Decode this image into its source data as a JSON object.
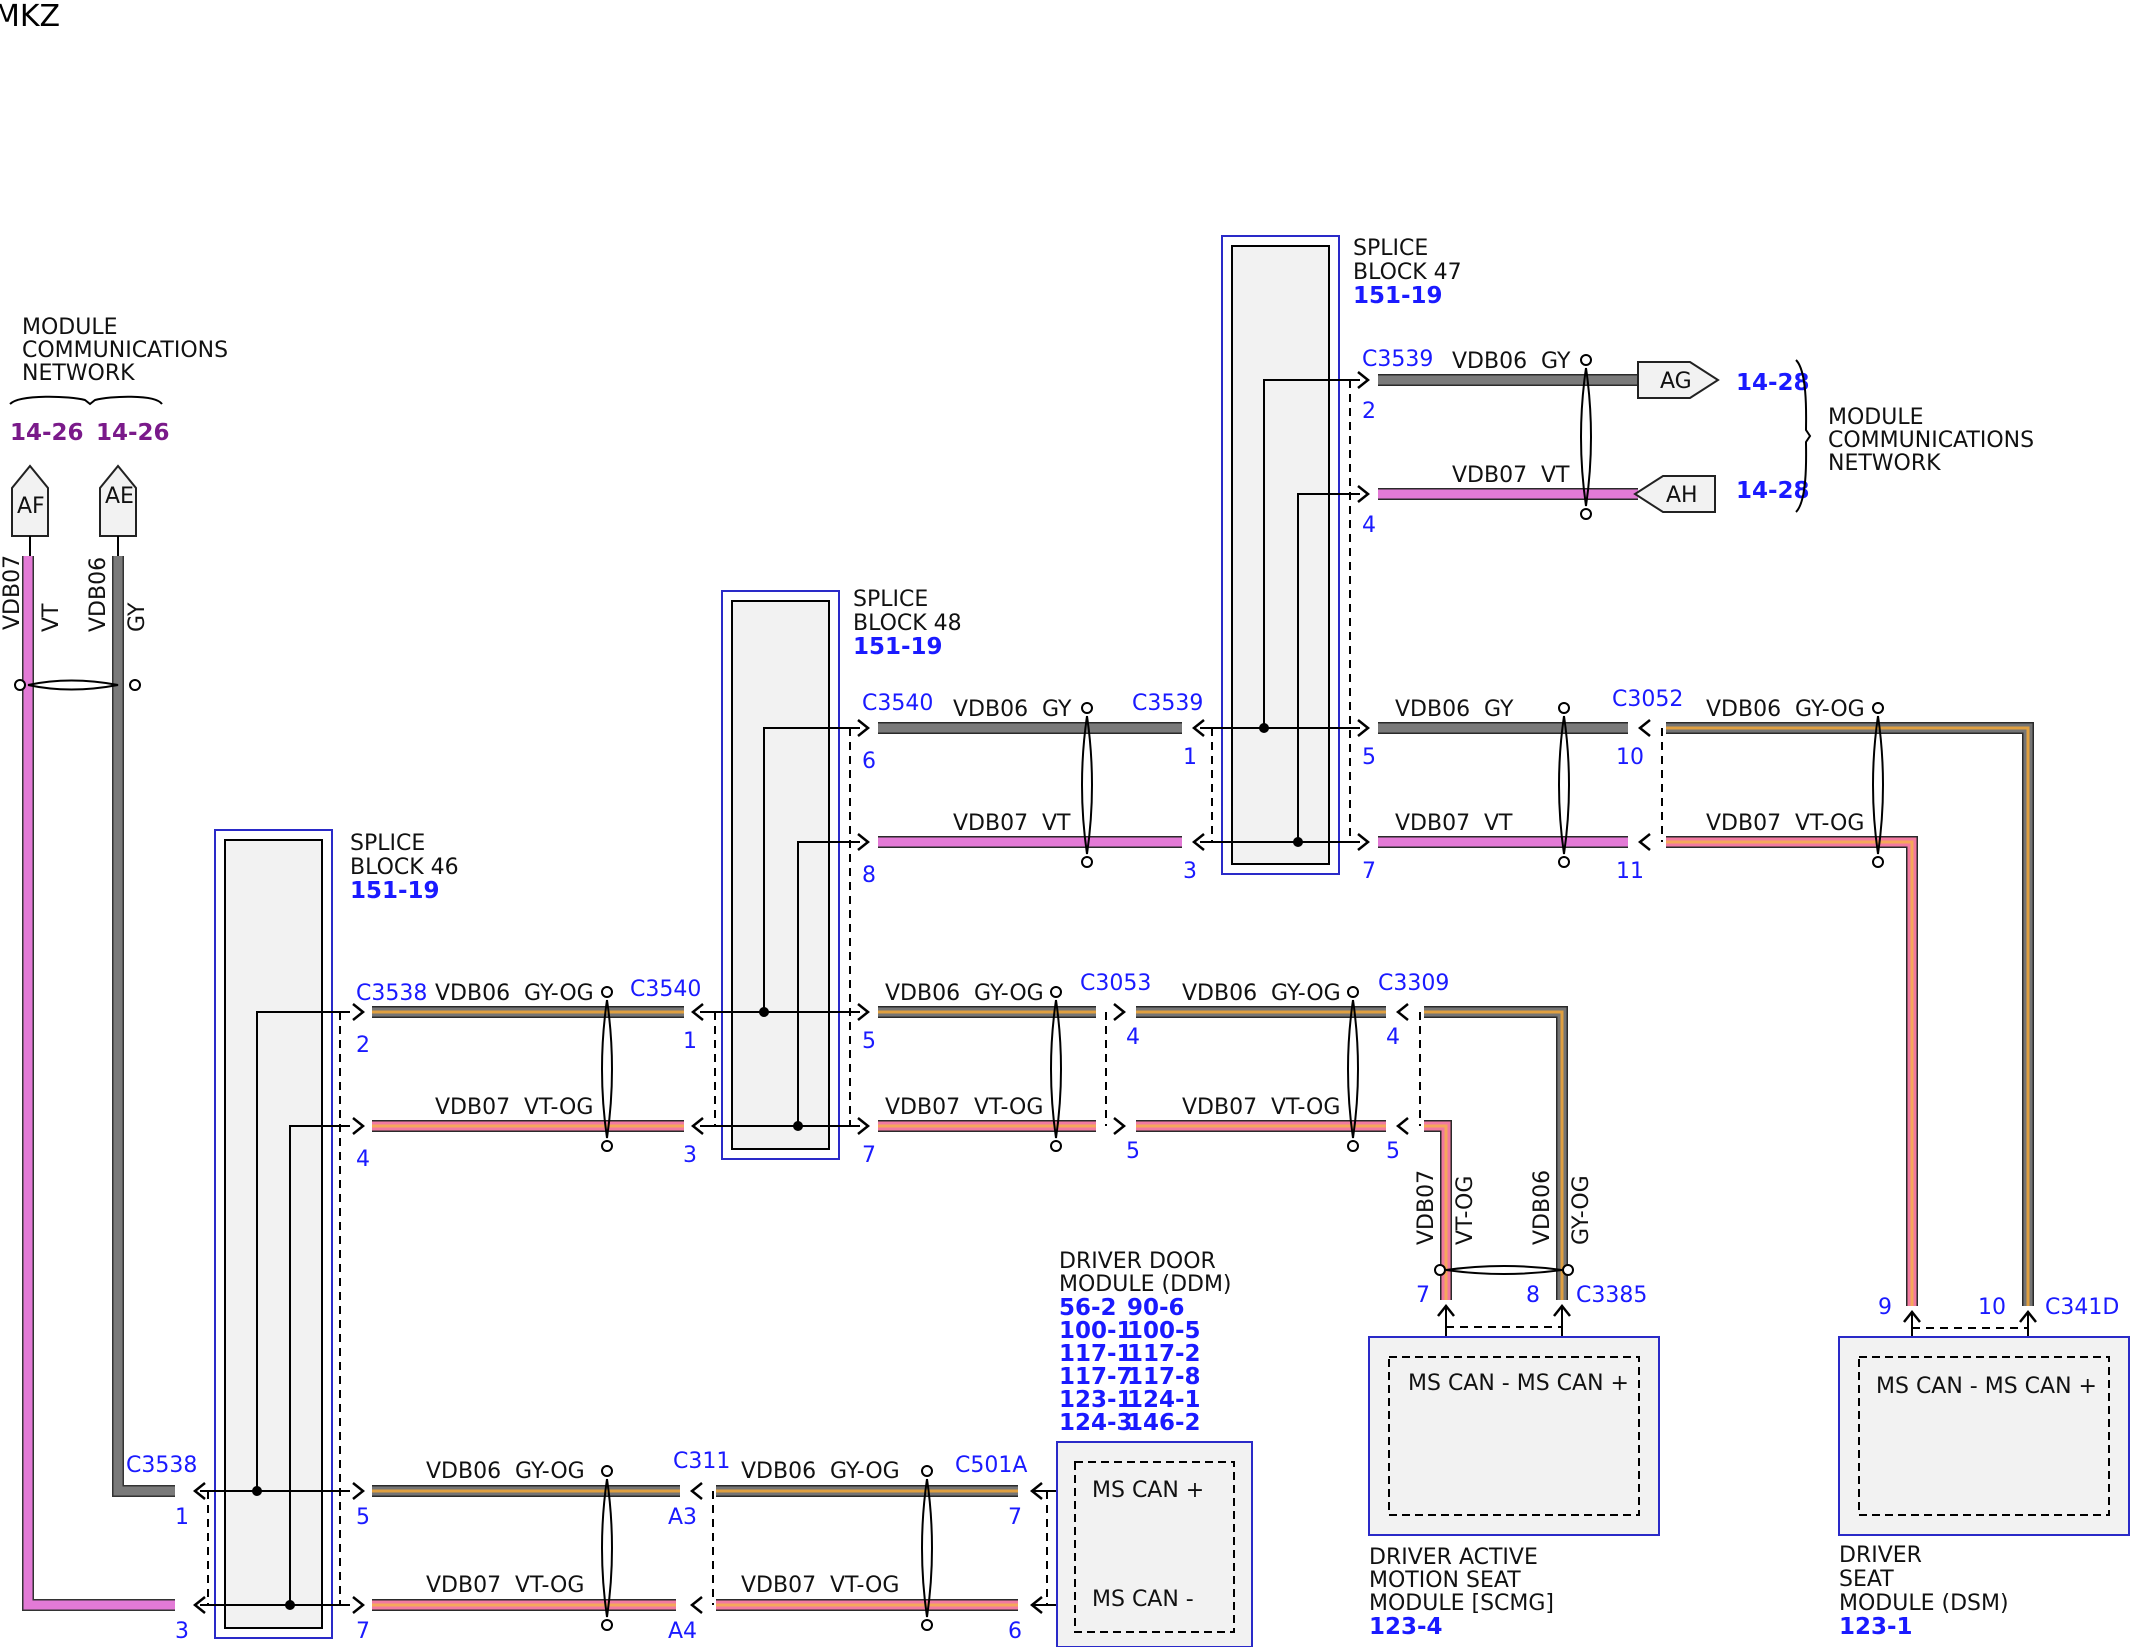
{
  "page": {
    "title": "MKZ"
  },
  "colors": {
    "gy": "#7a7a7a",
    "vt": "#e37ad6",
    "gy_og_base": "#757575",
    "gy_og_stripe": "#e0a040",
    "vt_og_base": "#f27aa0",
    "vt_og_stripe": "#f5a85a",
    "connector_text": "#1a1aff",
    "module_ref": "#1a1aff",
    "network_ref": "#7a1a8a",
    "box_border": "#2a2ac8",
    "box_fill": "#f2f2f2"
  },
  "network_left": {
    "title_line1": "MODULE",
    "title_line2": "COMMUNICATIONS",
    "title_line3": "NETWORK",
    "ref_a": "14-26",
    "ref_b": "14-26",
    "tag_af": "AF",
    "tag_ae": "AE",
    "wire_af_name": "VDB07",
    "wire_af_color": "VT",
    "wire_ae_name": "VDB06",
    "wire_ae_color": "GY"
  },
  "network_right": {
    "title_line1": "MODULE",
    "title_line2": "COMMUNICATIONS",
    "title_line3": "NETWORK",
    "tag_ag": "AG",
    "tag_ah": "AH",
    "ref_ag": "14-28",
    "ref_ah": "14-28"
  },
  "splice46": {
    "line1": "SPLICE",
    "line2": "BLOCK 46",
    "ref": "151-19"
  },
  "splice47": {
    "line1": "SPLICE",
    "line2": "BLOCK 47",
    "ref": "151-19"
  },
  "splice48": {
    "line1": "SPLICE",
    "line2": "BLOCK 48",
    "ref": "151-19"
  },
  "connectors": {
    "c3538_a": "C3538",
    "c3538_b": "C3538",
    "c3540_a": "C3540",
    "c3540_b": "C3540",
    "c3539_a": "C3539",
    "c3539_b": "C3539",
    "c3052": "C3052",
    "c3053": "C3053",
    "c3309": "C3309",
    "c311": "C311",
    "c501a": "C501A",
    "c3385": "C3385",
    "c341d": "C341D"
  },
  "pins": {
    "sb46_2": "2",
    "sb46_4": "4",
    "sb46_5": "5",
    "sb46_7": "7",
    "left_1": "1",
    "left_3": "3",
    "sb48_in_1": "1",
    "sb48_in_3": "3",
    "sb48_6": "6",
    "sb48_8": "8",
    "sb48_5": "5",
    "sb48_7": "7",
    "sb47_in_1": "1",
    "sb47_in_3": "3",
    "sb47_2": "2",
    "sb47_4": "4",
    "sb47_5": "5",
    "sb47_7": "7",
    "c3052_10": "10",
    "c3052_11": "11",
    "c3053_4": "4",
    "c3053_5": "5",
    "c3309_4": "4",
    "c3309_5": "5",
    "c311_a3": "A3",
    "c311_a4": "A4",
    "c501a_7": "7",
    "c501a_6": "6",
    "c3385_7": "7",
    "c3385_8": "8",
    "c341d_9": "9",
    "c341d_10": "10"
  },
  "wires": {
    "w_sb48_gy": {
      "name": "VDB06",
      "color": "GY"
    },
    "w_sb48_vt": {
      "name": "VDB07",
      "color": "VT"
    },
    "w_sb47_ag": {
      "name": "VDB06",
      "color": "GY"
    },
    "w_sb47_ah": {
      "name": "VDB07",
      "color": "VT"
    },
    "w_sb47_gy": {
      "name": "VDB06",
      "color": "GY"
    },
    "w_sb47_vt": {
      "name": "VDB07",
      "color": "VT"
    },
    "w_dsm_gyog": {
      "name": "VDB06",
      "color": "GY-OG"
    },
    "w_dsm_vtog": {
      "name": "VDB07",
      "color": "VT-OG"
    },
    "w_sb46_gyog": {
      "name": "VDB06",
      "color": "GY-OG"
    },
    "w_sb46_vtog": {
      "name": "VDB07",
      "color": "VT-OG"
    },
    "w_c3053_gyog": {
      "name": "VDB06",
      "color": "GY-OG"
    },
    "w_c3053_vtog": {
      "name": "VDB07",
      "color": "VT-OG"
    },
    "w_c3309_gyog": {
      "name": "VDB06",
      "color": "GY-OG"
    },
    "w_c3309_vtog": {
      "name": "VDB07",
      "color": "VT-OG"
    },
    "w_c311_gyog": {
      "name": "VDB06",
      "color": "GY-OG"
    },
    "w_c311_vtog": {
      "name": "VDB07",
      "color": "VT-OG"
    },
    "w_c501_gyog": {
      "name": "VDB06",
      "color": "GY-OG"
    },
    "w_c501_vtog": {
      "name": "VDB07",
      "color": "VT-OG"
    },
    "w_scmg_vt": {
      "name": "VDB07",
      "color": "VT-OG"
    },
    "w_scmg_gy": {
      "name": "VDB06",
      "color": "GY-OG"
    }
  },
  "ddm": {
    "line1": "DRIVER DOOR",
    "line2": "MODULE (DDM)",
    "refs": [
      [
        "56-2",
        "90-6"
      ],
      [
        "100-1",
        "100-5"
      ],
      [
        "117-1",
        "117-2"
      ],
      [
        "117-7",
        "117-8"
      ],
      [
        "123-1",
        "124-1"
      ],
      [
        "124-3",
        "146-2"
      ]
    ],
    "pin_plus": "MS CAN +",
    "pin_minus": "MS CAN -"
  },
  "scmg": {
    "inner": "MS CAN - MS CAN +",
    "line1": "DRIVER ACTIVE",
    "line2": "MOTION SEAT",
    "line3": "MODULE [SCMG]",
    "ref": "123-4"
  },
  "dsm": {
    "inner": "MS CAN - MS CAN +",
    "line1": "DRIVER",
    "line2": "SEAT",
    "line3": "MODULE (DSM)",
    "ref": "123-1"
  }
}
